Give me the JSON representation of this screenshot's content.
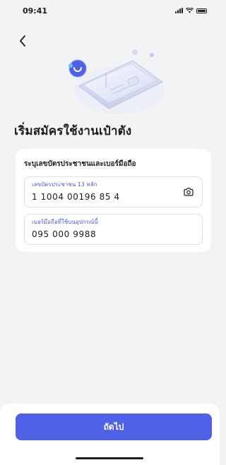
{
  "status_bar": {
    "time": "09:41",
    "icons": [
      "signal-icon",
      "wifi-icon",
      "battery-icon"
    ]
  },
  "nav": {
    "back_icon": "chevron-left-icon"
  },
  "hero": {
    "illustration": "id-card-illustration"
  },
  "page": {
    "title": "เริ่มสมัครใช้งานเป๋าตัง"
  },
  "form": {
    "heading": "ระบุเลขบัตรประชาชนและเบอร์มือถือ",
    "id_field": {
      "label": "เลขบัตรประชาชน 13 หลัก",
      "value": "1 1004 00196 85 4",
      "action_icon": "camera-icon"
    },
    "phone_field": {
      "label": "เบอร์มือถือที่ใช้บนอุปกรณ์นี้",
      "value": "095 000 9988"
    }
  },
  "footer": {
    "next_label": "ถัดไป"
  },
  "colors": {
    "accent": "#4f62e6",
    "label": "#4a5fd9",
    "background": "#f2f3f5",
    "card": "#ffffff"
  }
}
